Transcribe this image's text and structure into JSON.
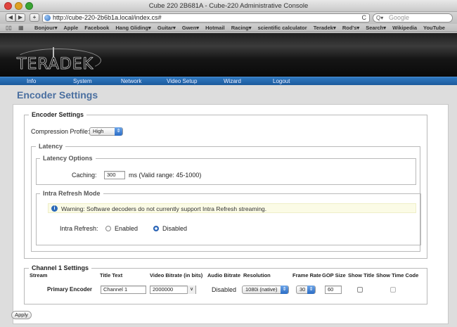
{
  "window": {
    "title": "Cube 220 2B681A - Cube-220 Administrative Console"
  },
  "browser": {
    "url": "http://cube-220-2b6b1a.local/index.cs#",
    "search_placeholder": "Google",
    "bookmarks": [
      "Bonjour▾",
      "Apple",
      "Facebook",
      "Hang Gliding▾",
      "Guitar▾",
      "Gwen▾",
      "Hotmail",
      "Racing▾",
      "scientific calculator",
      "Teradek▾",
      "Rod's▾",
      "Search▾",
      "Wikipedia",
      "YouTube"
    ]
  },
  "brand": {
    "logo": "TERADEK"
  },
  "nav": [
    "Info",
    "System",
    "Network",
    "Video Setup",
    "Wizard",
    "Logout"
  ],
  "page_title": "Encoder Settings",
  "encoder": {
    "legend": "Encoder Settings",
    "profile_label": "Compression Profile:",
    "profile_value": "High",
    "latency": {
      "legend": "Latency",
      "options_legend": "Latency Options",
      "caching_label": "Caching:",
      "caching_value": "300",
      "caching_hint": "ms (Valid range: 45-1000)"
    },
    "intra": {
      "legend": "Intra Refresh Mode",
      "warning": "Warning: Software decoders do not currently support Intra Refresh streaming.",
      "label": "Intra Refresh:",
      "enabled_label": "Enabled",
      "disabled_label": "Disabled",
      "selected": "Disabled"
    }
  },
  "channel": {
    "legend": "Channel 1 Settings",
    "headers": [
      "Stream",
      "Title Text",
      "Video Bitrate (in bits)",
      "Audio Bitrate",
      "Resolution",
      "Frame Rate",
      "GOP Size",
      "Show Title",
      "Show Time Code"
    ],
    "row": {
      "stream": "Primary Encoder",
      "title_text": "Channel 1",
      "video_bitrate": "2000000",
      "audio_bitrate": "Disabled",
      "resolution": "1080i (native)",
      "frame_rate": "30",
      "gop_size": "60"
    }
  },
  "apply_label": "Apply",
  "colors": {
    "nav_blue": "#1c5a9c",
    "heading": "#4a6fa0",
    "warning_bg": "#fbfbe6"
  }
}
